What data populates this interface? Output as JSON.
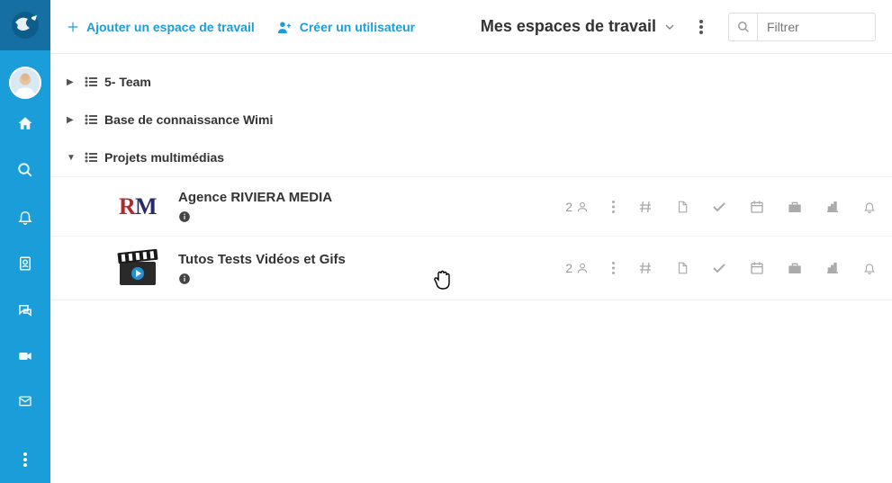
{
  "sidebar": {
    "nav_icons": [
      "home-icon",
      "search-icon",
      "bell-icon",
      "contacts-icon",
      "chat-icon",
      "video-icon",
      "mail-icon"
    ]
  },
  "topbar": {
    "add_workspace_label": "Ajouter un espace de travail",
    "create_user_label": "Créer un utilisateur",
    "view_selector_label": "Mes espaces de travail",
    "filter_placeholder": "Filtrer"
  },
  "tree": [
    {
      "label": "5- Team",
      "expanded": false
    },
    {
      "label": "Base de connaissance Wimi",
      "expanded": false
    },
    {
      "label": "Projets multimédias",
      "expanded": true
    }
  ],
  "workspaces": [
    {
      "title": "Agence RIVIERA MEDIA",
      "members": "2",
      "thumb": "rm"
    },
    {
      "title": "Tutos Tests Vidéos et Gifs",
      "members": "2",
      "thumb": "clap"
    }
  ],
  "colors": {
    "primary": "#1b9dd9"
  }
}
